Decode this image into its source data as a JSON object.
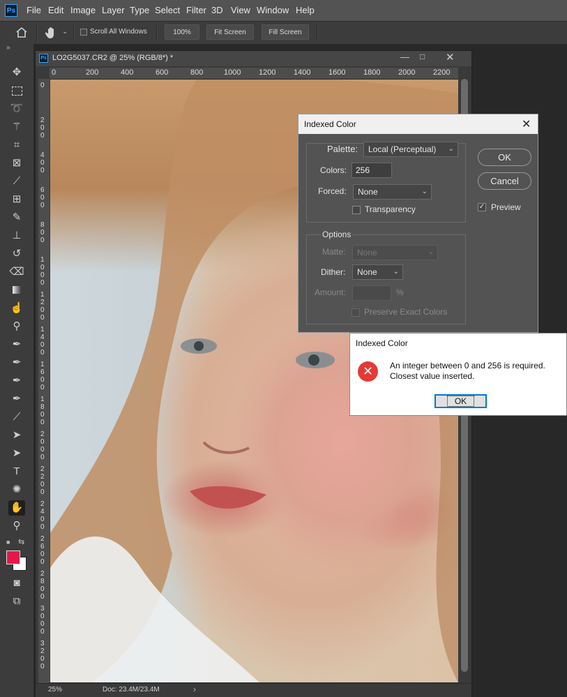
{
  "menu": {
    "logo": "Ps",
    "items": [
      "File",
      "Edit",
      "Image",
      "Layer",
      "Type",
      "Select",
      "Filter",
      "3D",
      "View",
      "Window",
      "Help"
    ]
  },
  "options": {
    "scroll_all_windows": "Scroll All Windows",
    "zoom_100": "100%",
    "fit_screen": "Fit Screen",
    "fill_screen": "Fill Screen"
  },
  "document": {
    "title": "LO2G5037.CR2 @ 25% (RGB/8*) *",
    "ruler_h": [
      "0",
      "200",
      "400",
      "600",
      "800",
      "1000",
      "1200",
      "1400",
      "1600",
      "1800",
      "2000",
      "2200"
    ],
    "ruler_v": [
      "0",
      "200",
      "400",
      "600",
      "800",
      "1000",
      "1200",
      "1400",
      "1600",
      "1800",
      "2000",
      "2200",
      "2400",
      "2600",
      "2800",
      "3000",
      "3200"
    ],
    "zoom": "25%",
    "doc_size": "Doc: 23.4M/23.4M"
  },
  "indexed_dialog": {
    "title": "Indexed Color",
    "palette_label": "Palette:",
    "palette_value": "Local (Perceptual)",
    "colors_label": "Colors:",
    "colors_value": "256",
    "forced_label": "Forced:",
    "forced_value": "None",
    "transparency_label": "Transparency",
    "options_heading": "Options",
    "matte_label": "Matte:",
    "matte_value": "None",
    "dither_label": "Dither:",
    "dither_value": "None",
    "amount_label": "Amount:",
    "amount_unit": "%",
    "preserve_label": "Preserve Exact Colors",
    "ok_label": "OK",
    "cancel_label": "Cancel",
    "preview_label": "Preview",
    "preview_checked": true
  },
  "alert": {
    "title": "Indexed Color",
    "line1": "An integer between 0 and 256 is required.",
    "line2": "Closest value inserted.",
    "ok_label": "OK"
  },
  "colors": {
    "foreground": "#e8174a",
    "background": "#ffffff",
    "error_icon": "#e53935"
  }
}
